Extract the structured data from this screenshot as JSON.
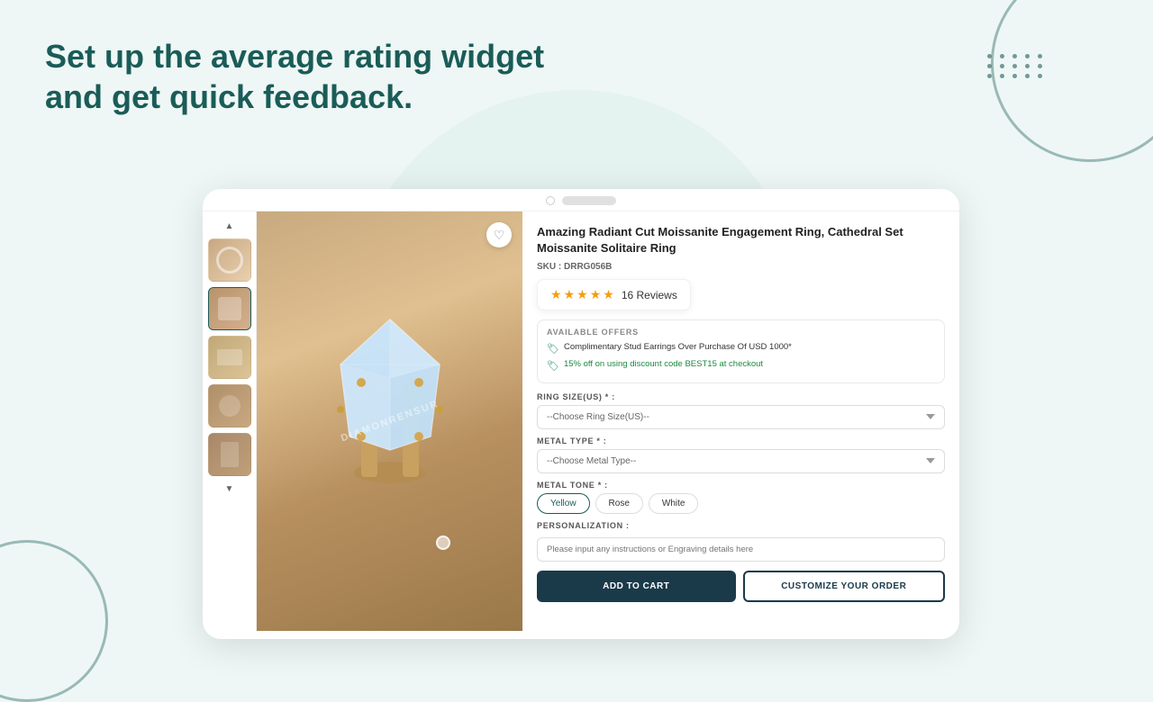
{
  "headline": {
    "line1": "Set up the average rating widget",
    "line2": "and get quick feedback."
  },
  "product": {
    "title": "Amazing Radiant Cut Moissanite Engagement Ring, Cathedral Set Moissanite Solitaire Ring",
    "sku_label": "SKU :",
    "sku_value": "DRRG056B",
    "rating": {
      "value": 5,
      "stars": [
        "★",
        "★",
        "★",
        "★",
        "★"
      ],
      "count": "16 Reviews"
    },
    "offers": {
      "title": "AVAILABLE OFFERS",
      "items": [
        "Complimentary Stud Earrings Over Purchase Of USD 1000*",
        "15% off on using discount code BEST15 at checkout"
      ]
    },
    "ring_size_label": "RING SIZE(US) * :",
    "ring_size_placeholder": "--Choose Ring Size(US)--",
    "metal_type_label": "METAL TYPE * :",
    "metal_type_placeholder": "--Choose Metal Type--",
    "metal_tone_label": "METAL TONE * :",
    "metal_tones": [
      "Yellow",
      "Rose",
      "White"
    ],
    "active_tone": "Yellow",
    "personalization_label": "PERSONALIZATION :",
    "personalization_placeholder": "Please input any instructions or Engraving details here",
    "watermark": "DIAMONRENSUR",
    "heart_icon": "♡",
    "add_to_cart": "ADD TO CART",
    "customize_order": "CUSTOMIZE YOUR ORDER"
  },
  "thumbnails": [
    {
      "id": "t1",
      "active": false
    },
    {
      "id": "t2",
      "active": true
    },
    {
      "id": "t3",
      "active": false
    },
    {
      "id": "t4",
      "active": false
    },
    {
      "id": "t5",
      "active": false
    }
  ]
}
